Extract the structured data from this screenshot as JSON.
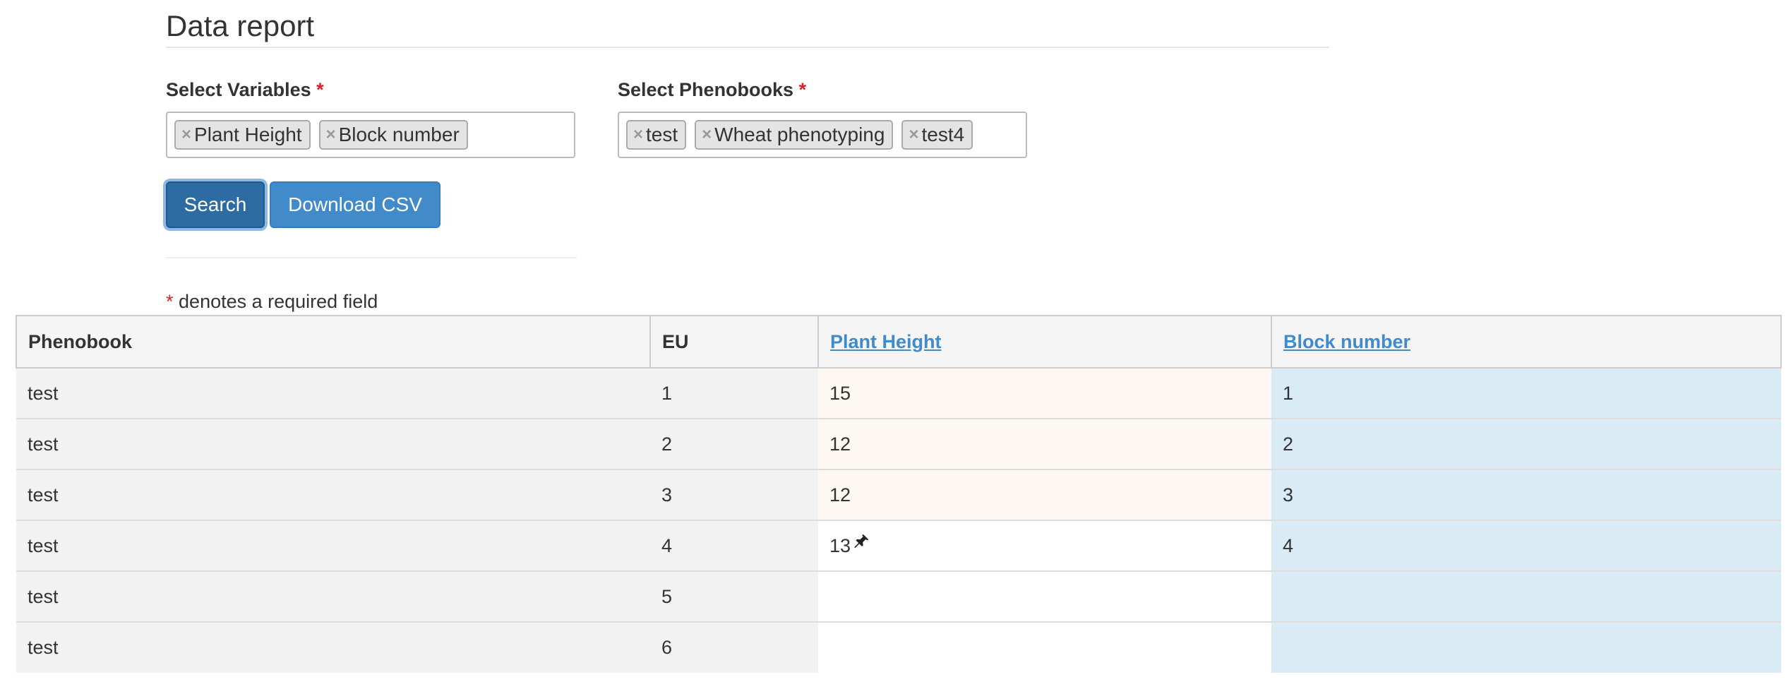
{
  "page": {
    "title": "Data report"
  },
  "form": {
    "variables_label": "Select Variables",
    "phenobooks_label": "Select Phenobooks",
    "required_marker": "*",
    "variables": [
      "Plant Height",
      "Block number"
    ],
    "phenobooks": [
      "test",
      "Wheat phenotyping",
      "test4"
    ],
    "remove_glyph": "×",
    "search_label": "Search",
    "download_label": "Download CSV",
    "required_note": "denotes a required field"
  },
  "table": {
    "columns": [
      "Phenobook",
      "EU",
      "Plant Height",
      "Block number"
    ],
    "rows": [
      {
        "phenobook": "test",
        "eu": "1",
        "plant_height": "15",
        "block_number": "1"
      },
      {
        "phenobook": "test",
        "eu": "2",
        "plant_height": "12",
        "block_number": "2"
      },
      {
        "phenobook": "test",
        "eu": "3",
        "plant_height": "12",
        "block_number": "3"
      },
      {
        "phenobook": "test",
        "eu": "4",
        "plant_height": "13",
        "block_number": "4"
      },
      {
        "phenobook": "test",
        "eu": "5",
        "plant_height": "",
        "block_number": ""
      },
      {
        "phenobook": "test",
        "eu": "6",
        "plant_height": "",
        "block_number": ""
      }
    ],
    "pinned_row_icon": "pin-icon",
    "colors": {
      "link": "#428bca",
      "primary_button": "#428bca",
      "required": "#d9232d",
      "plant_height_cell": "#fdf8f2",
      "block_number_cell": "#d9ecf6"
    }
  }
}
